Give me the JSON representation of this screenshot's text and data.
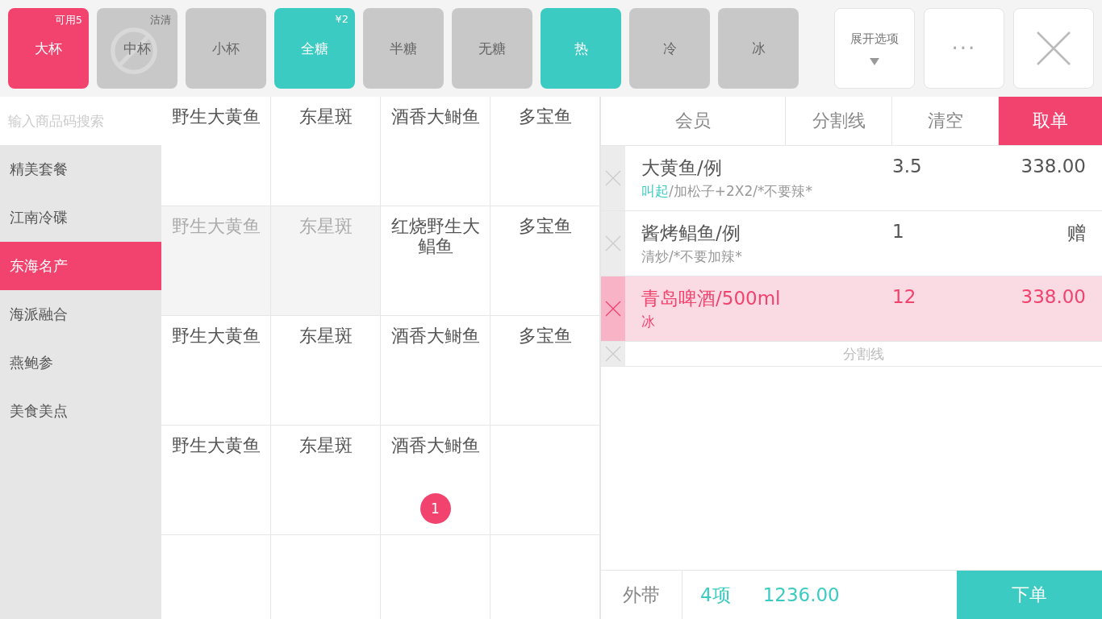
{
  "option_groups": [
    {
      "color": "#f2436f",
      "options": [
        {
          "label": "大杯",
          "selected": true,
          "badge": "可用5",
          "sold_out": false
        },
        {
          "label": "中杯",
          "selected": false,
          "badge": "沽清",
          "sold_out": true
        },
        {
          "label": "小杯",
          "selected": false,
          "sold_out": false
        }
      ]
    },
    {
      "color": "#3ccbc2",
      "options": [
        {
          "label": "全糖",
          "selected": true,
          "badge": "¥2",
          "sold_out": false
        },
        {
          "label": "半糖",
          "selected": false,
          "sold_out": false
        },
        {
          "label": "无糖",
          "selected": false,
          "sold_out": false
        }
      ]
    },
    {
      "color": "#3ccbc2",
      "options": [
        {
          "label": "热",
          "selected": true,
          "sold_out": false
        },
        {
          "label": "冷",
          "selected": false,
          "sold_out": false
        },
        {
          "label": "冰",
          "selected": false,
          "sold_out": false
        }
      ]
    }
  ],
  "expand_button": {
    "label": "展开选项"
  },
  "more_button": {
    "label": "···"
  },
  "search": {
    "placeholder": "输入商品码搜索"
  },
  "categories": [
    {
      "label": "精美套餐",
      "selected": false
    },
    {
      "label": "江南冷碟",
      "selected": false
    },
    {
      "label": "东海名产",
      "selected": true
    },
    {
      "label": "海派融合",
      "selected": false
    },
    {
      "label": "燕鲍参",
      "selected": false
    },
    {
      "label": "美食美点",
      "selected": false
    }
  ],
  "dishes": [
    {
      "name": "野生大黄鱼",
      "disabled": false
    },
    {
      "name": "东星斑",
      "disabled": false
    },
    {
      "name": "酒香大鲥鱼",
      "disabled": false
    },
    {
      "name": "多宝鱼",
      "disabled": false
    },
    {
      "name": "野生大黄鱼",
      "disabled": true
    },
    {
      "name": "东星斑",
      "disabled": true
    },
    {
      "name": "红烧野生大鲳鱼",
      "disabled": false
    },
    {
      "name": "多宝鱼",
      "disabled": false
    },
    {
      "name": "野生大黄鱼",
      "disabled": false
    },
    {
      "name": "东星斑",
      "disabled": false
    },
    {
      "name": "酒香大鲥鱼",
      "disabled": false
    },
    {
      "name": "多宝鱼",
      "disabled": false
    },
    {
      "name": "野生大黄鱼",
      "disabled": false
    },
    {
      "name": "东星斑",
      "disabled": false
    },
    {
      "name": "酒香大鲥鱼",
      "disabled": false,
      "count": "1"
    }
  ],
  "order_tabs": [
    {
      "label": "会员",
      "selected": false
    },
    {
      "label": "分割线",
      "selected": false
    },
    {
      "label": "清空",
      "selected": false
    },
    {
      "label": "取单",
      "selected": true
    }
  ],
  "order_items": [
    {
      "kind": "item",
      "name": "大黄鱼/例",
      "qty": "3.5",
      "price": "338.00",
      "note_tag": "叫起",
      "note": "/加松子+2X2/*不要辣*",
      "selected": false
    },
    {
      "kind": "item",
      "name": "酱烤鲳鱼/例",
      "qty": "1",
      "price": "赠",
      "note": "清炒/*不要加辣*",
      "selected": false
    },
    {
      "kind": "item",
      "name": "青岛啤酒/500ml",
      "qty": "12",
      "price": "338.00",
      "note": "冰",
      "selected": true
    },
    {
      "kind": "divider",
      "name": "分割线",
      "selected": false
    }
  ],
  "footer": {
    "takeaway": "外带",
    "count": "4项",
    "total": "1236.00",
    "submit": "下单"
  }
}
